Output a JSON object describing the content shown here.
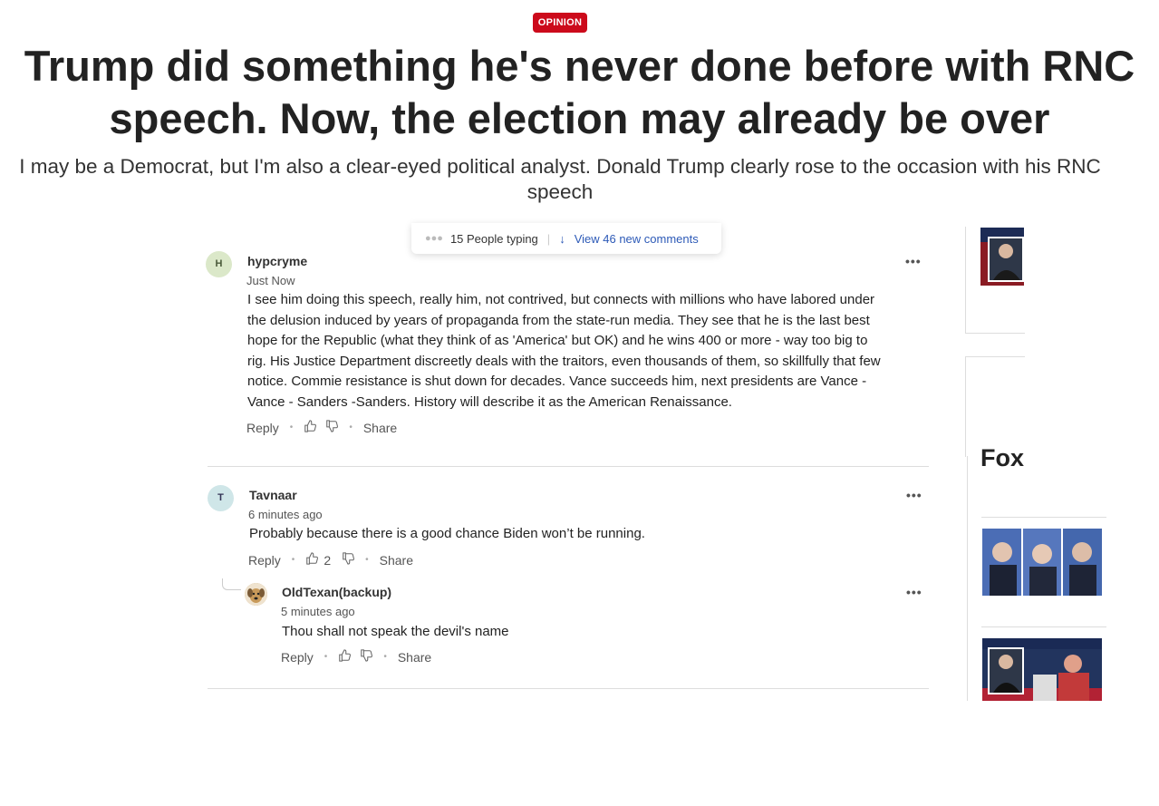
{
  "article": {
    "section_badge": "OPINION",
    "headline": "Trump did something he's never done before with RNC speech. Now, the election may already be over",
    "dek": "I may be a Democrat, but I'm also a clear-eyed political analyst. Donald Trump clearly rose to the occasion with his RNC speech"
  },
  "comments_bar": {
    "typing_dots": "●●●",
    "typing_text": "15 People typing",
    "new_comments_link": "View 46 new comments"
  },
  "comments": [
    {
      "avatar_initial": "H",
      "username": "hypcryme",
      "time": "Just Now",
      "body": "I see him doing this speech, really him, not contrived, but connects with millions who have labored under the delusion induced by years of propaganda from the state-run media.  They see that he is the last best hope for the Republic (what they think of as 'America' but OK) and he wins 400 or more - way too big to rig.  His Justice Department discreetly deals with the traitors, even thousands of them, so skillfully that few notice.  Commie resistance is shut down for decades.  Vance succeeds him, next presidents are Vance - Vance - Sanders -Sanders.  History will describe it as the American Renaissance.",
      "reply_label": "Reply",
      "share_label": "Share",
      "likes": ""
    },
    {
      "avatar_initial": "T",
      "username": "Tavnaar",
      "time": "6 minutes ago",
      "body": "Probably because there is a good chance Biden won’t be running.",
      "reply_label": "Reply",
      "share_label": "Share",
      "likes": "2"
    },
    {
      "avatar_initial": "",
      "username": "OldTexan(backup)",
      "time": "5 minutes ago",
      "body": "Thou shall not speak the devil's name",
      "reply_label": "Reply",
      "share_label": "Share",
      "likes": ""
    }
  ],
  "more_label": "•••",
  "sidebar": {
    "partial_title": "Fox"
  },
  "colors": {
    "badge": "#cc0a1b",
    "link": "#2d5ab7"
  }
}
